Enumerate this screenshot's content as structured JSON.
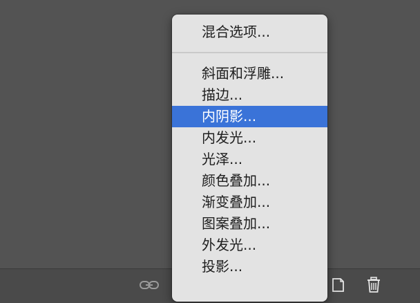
{
  "menu": {
    "header_item": "混合选项...",
    "items": [
      {
        "label": "斜面和浮雕...",
        "selected": false
      },
      {
        "label": "描边...",
        "selected": false
      },
      {
        "label": "内阴影...",
        "selected": true
      },
      {
        "label": "内发光...",
        "selected": false
      },
      {
        "label": "光泽...",
        "selected": false
      },
      {
        "label": "颜色叠加...",
        "selected": false
      },
      {
        "label": "渐变叠加...",
        "selected": false
      },
      {
        "label": "图案叠加...",
        "selected": false
      },
      {
        "label": "外发光...",
        "selected": false
      },
      {
        "label": "投影...",
        "selected": false
      }
    ]
  },
  "bottom_bar": {
    "icons": [
      "link-icon",
      "new-layer-icon",
      "trash-icon"
    ]
  },
  "colors": {
    "panel_bg": "#535353",
    "menu_bg": "#e3e3e3",
    "selection": "#3a73d8"
  }
}
